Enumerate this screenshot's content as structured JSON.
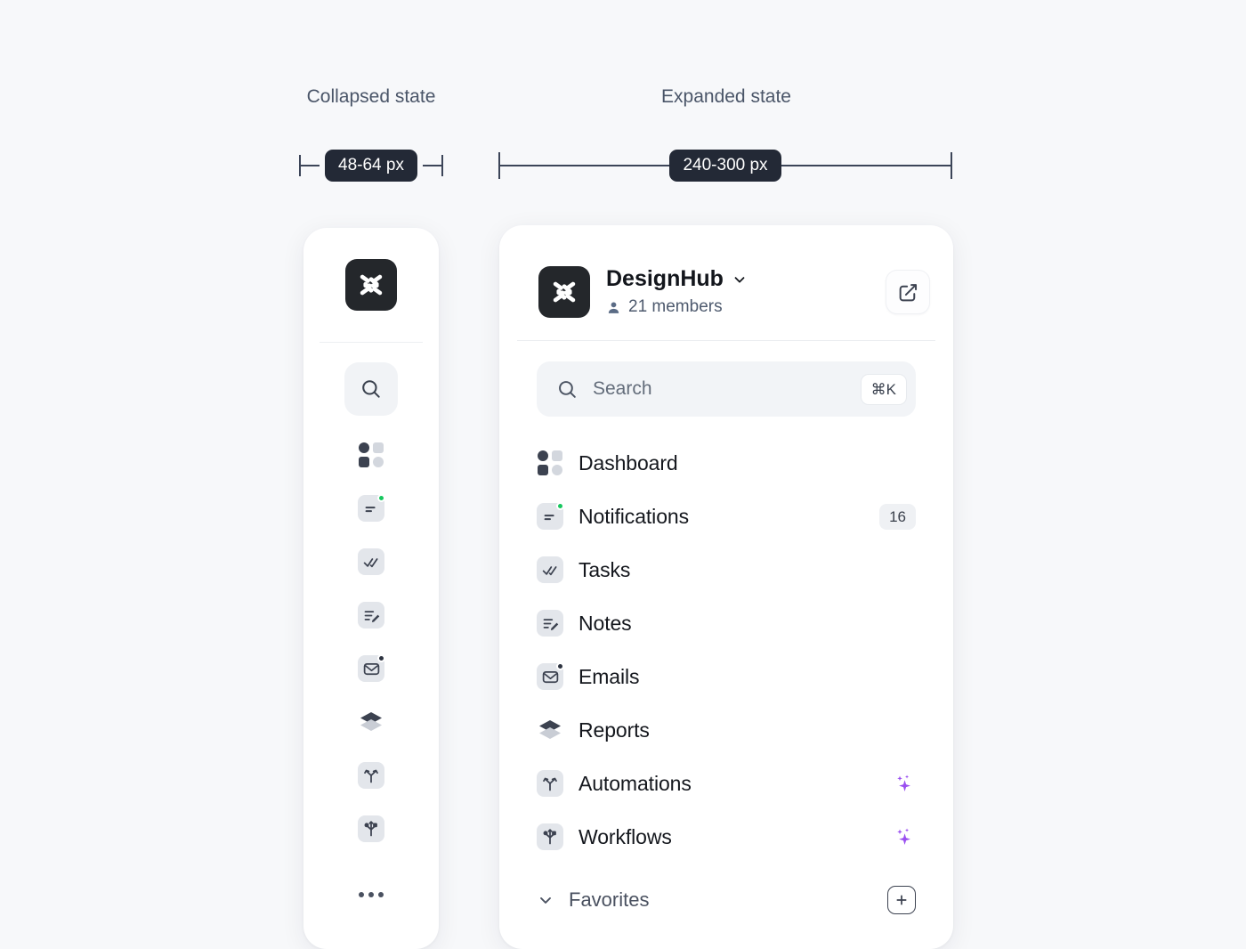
{
  "annotations": {
    "collapsed_caption": "Collapsed state",
    "expanded_caption": "Expanded state",
    "collapsed_dimension": "48-64 px",
    "expanded_dimension": "240-300 px"
  },
  "colors": {
    "page_background": "#F7F8FA",
    "panel_background": "#FFFFFF",
    "brand_mark": "#24272B",
    "dimension_pill": "#232936",
    "accent_ai_sparkle": "#9A4FF0",
    "status_dot_green": "#16C75E",
    "icon_tile": "#E3E6EB",
    "text_primary": "#14171D",
    "text_muted": "#4E5A6E"
  },
  "workspace": {
    "name": "DesignHub",
    "logo_icon": "designhub-logo-icon",
    "chevron_icon": "chevron-down-icon",
    "members_icon": "person-icon",
    "members_label": "21 members",
    "edit_button_icon": "compose-edit-icon"
  },
  "search": {
    "icon": "search-icon",
    "placeholder": "Search",
    "value": "",
    "shortcut": "⌘K"
  },
  "nav_items": [
    {
      "label": "Dashboard",
      "icon": "dashboard-grid-icon",
      "tile": false,
      "badge": null,
      "dot": null,
      "sparkle": false
    },
    {
      "label": "Notifications",
      "icon": "notification-list-icon",
      "tile": true,
      "badge": "16",
      "dot": "green",
      "sparkle": false
    },
    {
      "label": "Tasks",
      "icon": "double-check-icon",
      "tile": true,
      "badge": null,
      "dot": null,
      "sparkle": false
    },
    {
      "label": "Notes",
      "icon": "note-pencil-icon",
      "tile": true,
      "badge": null,
      "dot": null,
      "sparkle": false
    },
    {
      "label": "Emails",
      "icon": "envelope-icon",
      "tile": true,
      "badge": null,
      "dot": "dark",
      "sparkle": false
    },
    {
      "label": "Reports",
      "icon": "layers-stack-icon",
      "tile": false,
      "badge": null,
      "dot": null,
      "sparkle": false
    },
    {
      "label": "Automations",
      "icon": "branch-fork-icon",
      "tile": true,
      "badge": null,
      "dot": null,
      "sparkle": true
    },
    {
      "label": "Workflows",
      "icon": "workflow-merge-icon",
      "tile": true,
      "badge": null,
      "dot": null,
      "sparkle": true
    }
  ],
  "favorites_section": {
    "label": "Favorites",
    "chevron_icon": "chevron-down-icon",
    "add_icon": "plus-icon"
  },
  "collapsed_rail": {
    "logo_icon": "designhub-logo-icon",
    "search_icon": "search-icon",
    "more_icon": "more-horizontal-icon"
  }
}
